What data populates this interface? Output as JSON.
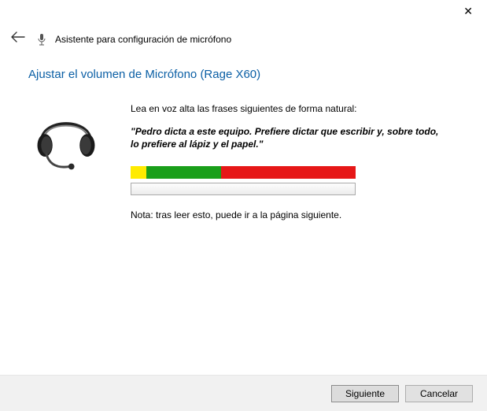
{
  "header": {
    "title": "Asistente para configuración de micrófono"
  },
  "page": {
    "title": "Ajustar el volumen de Micrófono (Rage X60)",
    "instruction": "Lea en voz alta las frases siguientes de forma natural:",
    "phrase": "\"Pedro dicta a este equipo. Prefiere dictar que escribir y, sobre todo, lo prefiere al lápiz y el papel.\"",
    "note": "Nota: tras leer esto, puede ir a la página siguiente."
  },
  "footer": {
    "next_label": "Siguiente",
    "cancel_label": "Cancelar"
  }
}
